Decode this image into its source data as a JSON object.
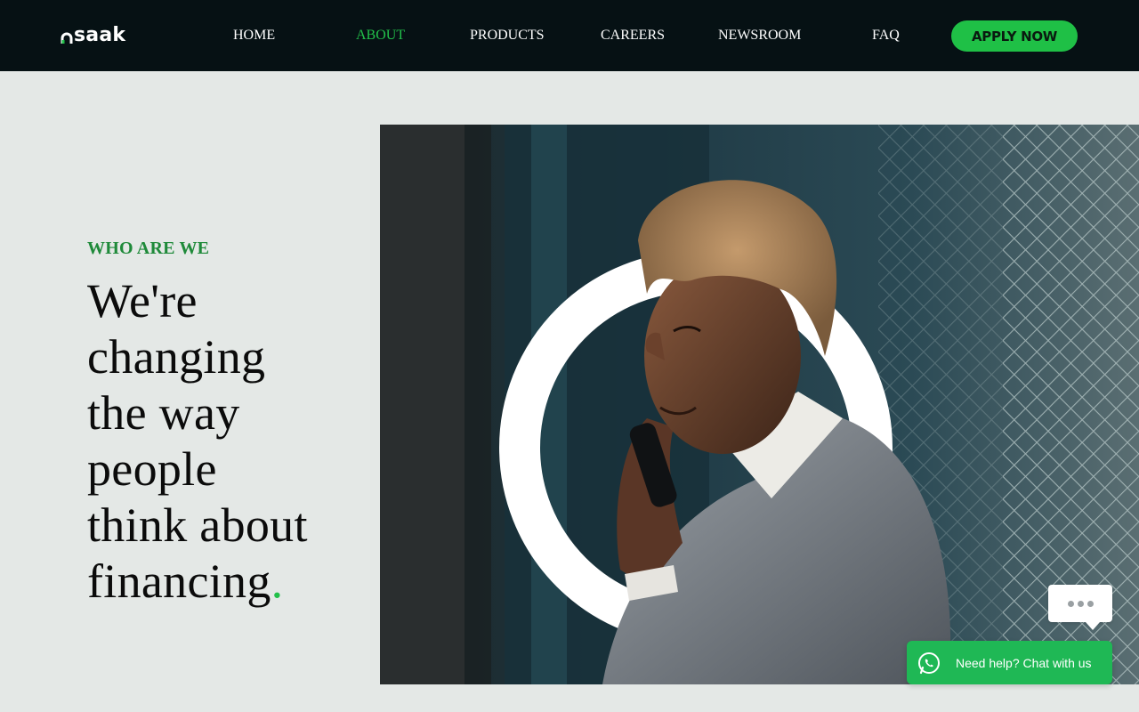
{
  "brand": {
    "logo_text": "saak",
    "accent": "#22c04a"
  },
  "nav": {
    "items": [
      {
        "label": "HOME",
        "active": false
      },
      {
        "label": "ABOUT",
        "active": true
      },
      {
        "label": "PRODUCTS",
        "active": false
      },
      {
        "label": "CAREERS",
        "active": false
      },
      {
        "label": "NEWSROOM",
        "active": false
      },
      {
        "label": "FAQ",
        "active": false
      }
    ],
    "cta_label": "APPLY NOW"
  },
  "hero": {
    "eyebrow": "WHO ARE WE",
    "headline_lines": [
      "We're",
      "changing",
      "the way",
      "people",
      "think about",
      "financing"
    ],
    "headline_end": ".",
    "image_icon": "photo-woman-on-phone"
  },
  "chat": {
    "label": "Need help? Chat with us",
    "icon": "whatsapp-icon",
    "typing_icon": "typing-dots-icon"
  }
}
